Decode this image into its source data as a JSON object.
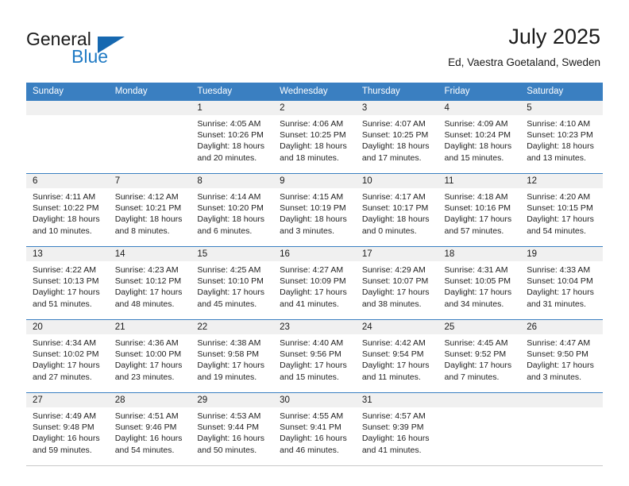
{
  "brand": {
    "word_one": "General",
    "word_two": "Blue",
    "flag_icon": "triangle-flag-icon",
    "accent_color": "#1668b0"
  },
  "header": {
    "title": "July 2025",
    "subtitle": "Ed, Vaestra Goetaland, Sweden"
  },
  "theme": {
    "header_blue": "#3a7fc1",
    "daynum_band": "#f0f0f0",
    "text": "#1a1a1a"
  },
  "weekday_headers": [
    "Sunday",
    "Monday",
    "Tuesday",
    "Wednesday",
    "Thursday",
    "Friday",
    "Saturday"
  ],
  "labels": {
    "sunrise_prefix": "Sunrise:",
    "sunset_prefix": "Sunset:",
    "daylight_prefix": "Daylight:"
  },
  "weeks": [
    [
      {
        "day": "",
        "line1": "",
        "line2": "",
        "line3": "",
        "line4": ""
      },
      {
        "day": "",
        "line1": "",
        "line2": "",
        "line3": "",
        "line4": ""
      },
      {
        "day": "1",
        "line1": "Sunrise: 4:05 AM",
        "line2": "Sunset: 10:26 PM",
        "line3": "Daylight: 18 hours",
        "line4": "and 20 minutes."
      },
      {
        "day": "2",
        "line1": "Sunrise: 4:06 AM",
        "line2": "Sunset: 10:25 PM",
        "line3": "Daylight: 18 hours",
        "line4": "and 18 minutes."
      },
      {
        "day": "3",
        "line1": "Sunrise: 4:07 AM",
        "line2": "Sunset: 10:25 PM",
        "line3": "Daylight: 18 hours",
        "line4": "and 17 minutes."
      },
      {
        "day": "4",
        "line1": "Sunrise: 4:09 AM",
        "line2": "Sunset: 10:24 PM",
        "line3": "Daylight: 18 hours",
        "line4": "and 15 minutes."
      },
      {
        "day": "5",
        "line1": "Sunrise: 4:10 AM",
        "line2": "Sunset: 10:23 PM",
        "line3": "Daylight: 18 hours",
        "line4": "and 13 minutes."
      }
    ],
    [
      {
        "day": "6",
        "line1": "Sunrise: 4:11 AM",
        "line2": "Sunset: 10:22 PM",
        "line3": "Daylight: 18 hours",
        "line4": "and 10 minutes."
      },
      {
        "day": "7",
        "line1": "Sunrise: 4:12 AM",
        "line2": "Sunset: 10:21 PM",
        "line3": "Daylight: 18 hours",
        "line4": "and 8 minutes."
      },
      {
        "day": "8",
        "line1": "Sunrise: 4:14 AM",
        "line2": "Sunset: 10:20 PM",
        "line3": "Daylight: 18 hours",
        "line4": "and 6 minutes."
      },
      {
        "day": "9",
        "line1": "Sunrise: 4:15 AM",
        "line2": "Sunset: 10:19 PM",
        "line3": "Daylight: 18 hours",
        "line4": "and 3 minutes."
      },
      {
        "day": "10",
        "line1": "Sunrise: 4:17 AM",
        "line2": "Sunset: 10:17 PM",
        "line3": "Daylight: 18 hours",
        "line4": "and 0 minutes."
      },
      {
        "day": "11",
        "line1": "Sunrise: 4:18 AM",
        "line2": "Sunset: 10:16 PM",
        "line3": "Daylight: 17 hours",
        "line4": "and 57 minutes."
      },
      {
        "day": "12",
        "line1": "Sunrise: 4:20 AM",
        "line2": "Sunset: 10:15 PM",
        "line3": "Daylight: 17 hours",
        "line4": "and 54 minutes."
      }
    ],
    [
      {
        "day": "13",
        "line1": "Sunrise: 4:22 AM",
        "line2": "Sunset: 10:13 PM",
        "line3": "Daylight: 17 hours",
        "line4": "and 51 minutes."
      },
      {
        "day": "14",
        "line1": "Sunrise: 4:23 AM",
        "line2": "Sunset: 10:12 PM",
        "line3": "Daylight: 17 hours",
        "line4": "and 48 minutes."
      },
      {
        "day": "15",
        "line1": "Sunrise: 4:25 AM",
        "line2": "Sunset: 10:10 PM",
        "line3": "Daylight: 17 hours",
        "line4": "and 45 minutes."
      },
      {
        "day": "16",
        "line1": "Sunrise: 4:27 AM",
        "line2": "Sunset: 10:09 PM",
        "line3": "Daylight: 17 hours",
        "line4": "and 41 minutes."
      },
      {
        "day": "17",
        "line1": "Sunrise: 4:29 AM",
        "line2": "Sunset: 10:07 PM",
        "line3": "Daylight: 17 hours",
        "line4": "and 38 minutes."
      },
      {
        "day": "18",
        "line1": "Sunrise: 4:31 AM",
        "line2": "Sunset: 10:05 PM",
        "line3": "Daylight: 17 hours",
        "line4": "and 34 minutes."
      },
      {
        "day": "19",
        "line1": "Sunrise: 4:33 AM",
        "line2": "Sunset: 10:04 PM",
        "line3": "Daylight: 17 hours",
        "line4": "and 31 minutes."
      }
    ],
    [
      {
        "day": "20",
        "line1": "Sunrise: 4:34 AM",
        "line2": "Sunset: 10:02 PM",
        "line3": "Daylight: 17 hours",
        "line4": "and 27 minutes."
      },
      {
        "day": "21",
        "line1": "Sunrise: 4:36 AM",
        "line2": "Sunset: 10:00 PM",
        "line3": "Daylight: 17 hours",
        "line4": "and 23 minutes."
      },
      {
        "day": "22",
        "line1": "Sunrise: 4:38 AM",
        "line2": "Sunset: 9:58 PM",
        "line3": "Daylight: 17 hours",
        "line4": "and 19 minutes."
      },
      {
        "day": "23",
        "line1": "Sunrise: 4:40 AM",
        "line2": "Sunset: 9:56 PM",
        "line3": "Daylight: 17 hours",
        "line4": "and 15 minutes."
      },
      {
        "day": "24",
        "line1": "Sunrise: 4:42 AM",
        "line2": "Sunset: 9:54 PM",
        "line3": "Daylight: 17 hours",
        "line4": "and 11 minutes."
      },
      {
        "day": "25",
        "line1": "Sunrise: 4:45 AM",
        "line2": "Sunset: 9:52 PM",
        "line3": "Daylight: 17 hours",
        "line4": "and 7 minutes."
      },
      {
        "day": "26",
        "line1": "Sunrise: 4:47 AM",
        "line2": "Sunset: 9:50 PM",
        "line3": "Daylight: 17 hours",
        "line4": "and 3 minutes."
      }
    ],
    [
      {
        "day": "27",
        "line1": "Sunrise: 4:49 AM",
        "line2": "Sunset: 9:48 PM",
        "line3": "Daylight: 16 hours",
        "line4": "and 59 minutes."
      },
      {
        "day": "28",
        "line1": "Sunrise: 4:51 AM",
        "line2": "Sunset: 9:46 PM",
        "line3": "Daylight: 16 hours",
        "line4": "and 54 minutes."
      },
      {
        "day": "29",
        "line1": "Sunrise: 4:53 AM",
        "line2": "Sunset: 9:44 PM",
        "line3": "Daylight: 16 hours",
        "line4": "and 50 minutes."
      },
      {
        "day": "30",
        "line1": "Sunrise: 4:55 AM",
        "line2": "Sunset: 9:41 PM",
        "line3": "Daylight: 16 hours",
        "line4": "and 46 minutes."
      },
      {
        "day": "31",
        "line1": "Sunrise: 4:57 AM",
        "line2": "Sunset: 9:39 PM",
        "line3": "Daylight: 16 hours",
        "line4": "and 41 minutes."
      },
      {
        "day": "",
        "line1": "",
        "line2": "",
        "line3": "",
        "line4": ""
      },
      {
        "day": "",
        "line1": "",
        "line2": "",
        "line3": "",
        "line4": ""
      }
    ]
  ]
}
